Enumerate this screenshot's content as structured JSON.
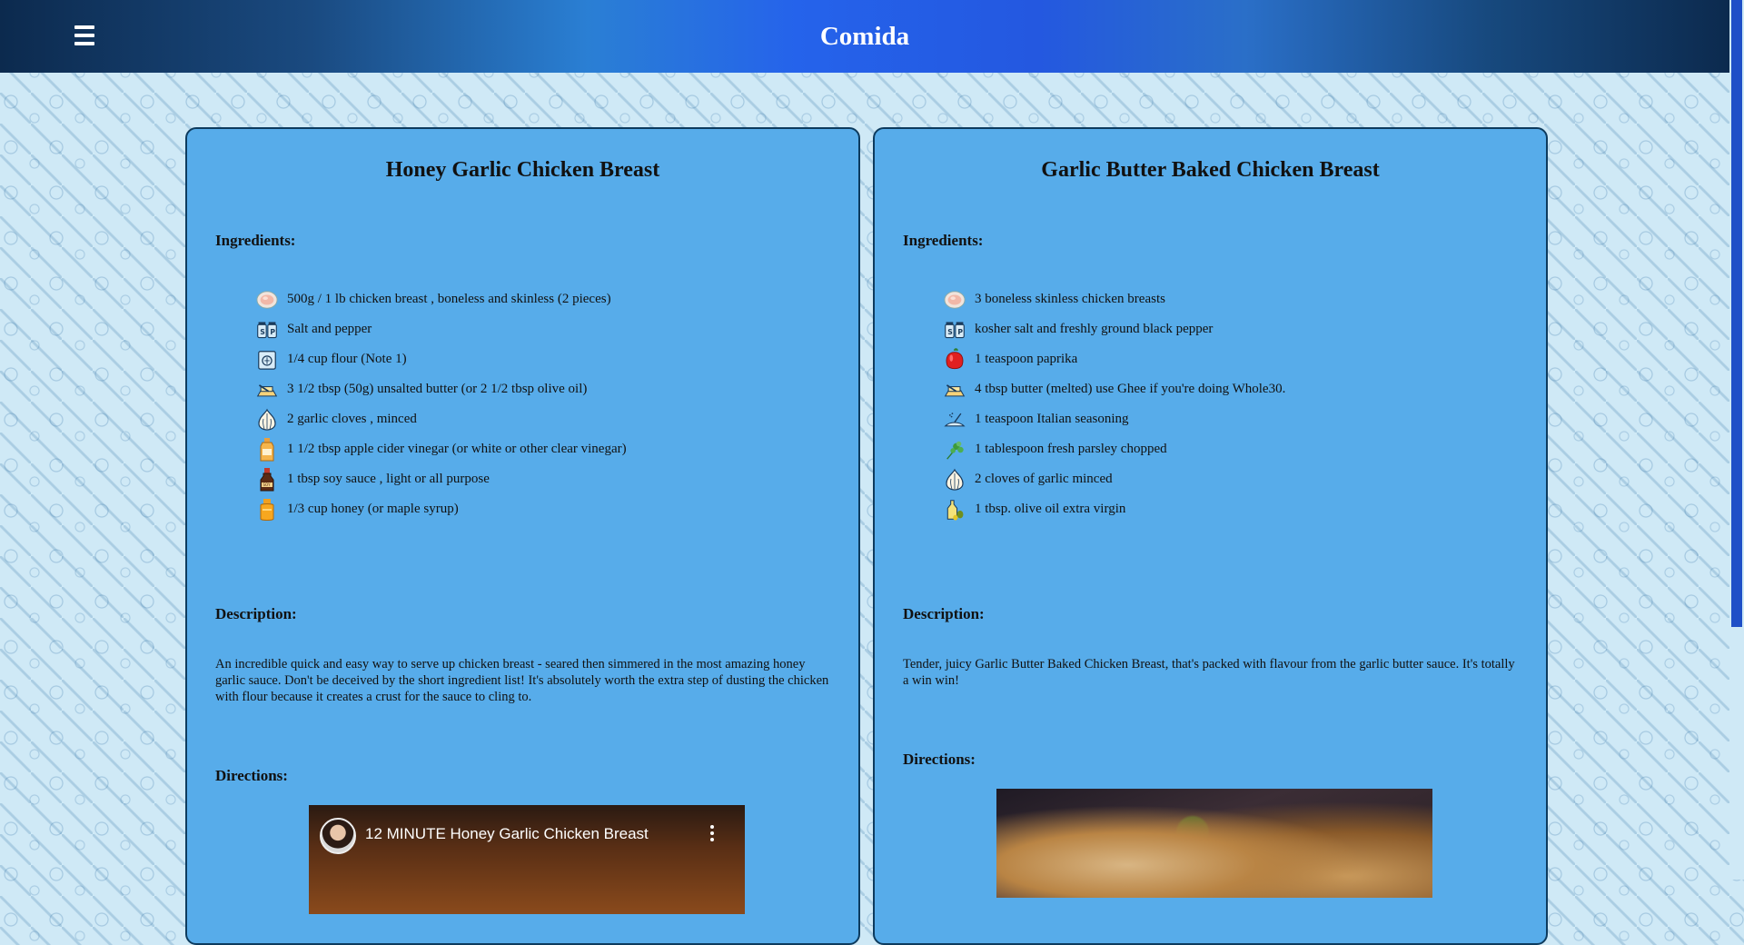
{
  "header": {
    "title": "Comida",
    "menu_icon": "hamburger-menu-icon"
  },
  "labels": {
    "ingredients": "Ingredients:",
    "description": "Description:",
    "directions": "Directions:"
  },
  "recipes": [
    {
      "title": "Honey Garlic Chicken Breast",
      "ingredients": [
        {
          "icon": "chicken-icon",
          "text": "500g / 1 lb chicken breast , boneless and skinless (2 pieces)"
        },
        {
          "icon": "salt-pepper-icon",
          "text": "Salt and pepper"
        },
        {
          "icon": "flour-icon",
          "text": "1/4 cup flour (Note 1)"
        },
        {
          "icon": "butter-icon",
          "text": "3 1/2 tbsp (50g) unsalted butter (or 2 1/2 tbsp olive oil)"
        },
        {
          "icon": "garlic-icon",
          "text": "2 garlic cloves , minced"
        },
        {
          "icon": "vinegar-icon",
          "text": "1 1/2 tbsp apple cider vinegar (or white or other clear vinegar)"
        },
        {
          "icon": "soy-sauce-icon",
          "text": "1 tbsp soy sauce , light or all purpose"
        },
        {
          "icon": "honey-icon",
          "text": "1/3 cup honey (or maple syrup)"
        }
      ],
      "description": "An incredible quick and easy way to serve up chicken breast - seared then simmered in the most amazing honey garlic sauce. Don't be deceived by the short ingredient list! It's absolutely worth the extra step of dusting the chicken with flour because it creates a crust for the sauce to cling to.",
      "video_title": "12 MINUTE Honey Garlic Chicken Breast"
    },
    {
      "title": "Garlic Butter Baked Chicken Breast",
      "ingredients": [
        {
          "icon": "chicken-icon",
          "text": "3 boneless skinless chicken breasts"
        },
        {
          "icon": "salt-pepper-icon",
          "text": "kosher salt and freshly ground black pepper"
        },
        {
          "icon": "paprika-icon",
          "text": "1 teaspoon paprika"
        },
        {
          "icon": "butter-icon",
          "text": "4 tbsp butter (melted) use Ghee if you're doing Whole30."
        },
        {
          "icon": "seasoning-icon",
          "text": "1 teaspoon Italian seasoning"
        },
        {
          "icon": "parsley-icon",
          "text": "1 tablespoon fresh parsley chopped"
        },
        {
          "icon": "garlic-icon",
          "text": "2 cloves of garlic minced"
        },
        {
          "icon": "olive-oil-icon",
          "text": "1 tbsp. olive oil extra virgin"
        }
      ],
      "description": "Tender, juicy Garlic Butter Baked Chicken Breast, that's packed with flavour from the garlic butter sauce. It's totally a win win!"
    }
  ],
  "colors": {
    "card_bg": "#57acea",
    "card_border": "#0d3b5e",
    "accent": "#2563eb"
  }
}
